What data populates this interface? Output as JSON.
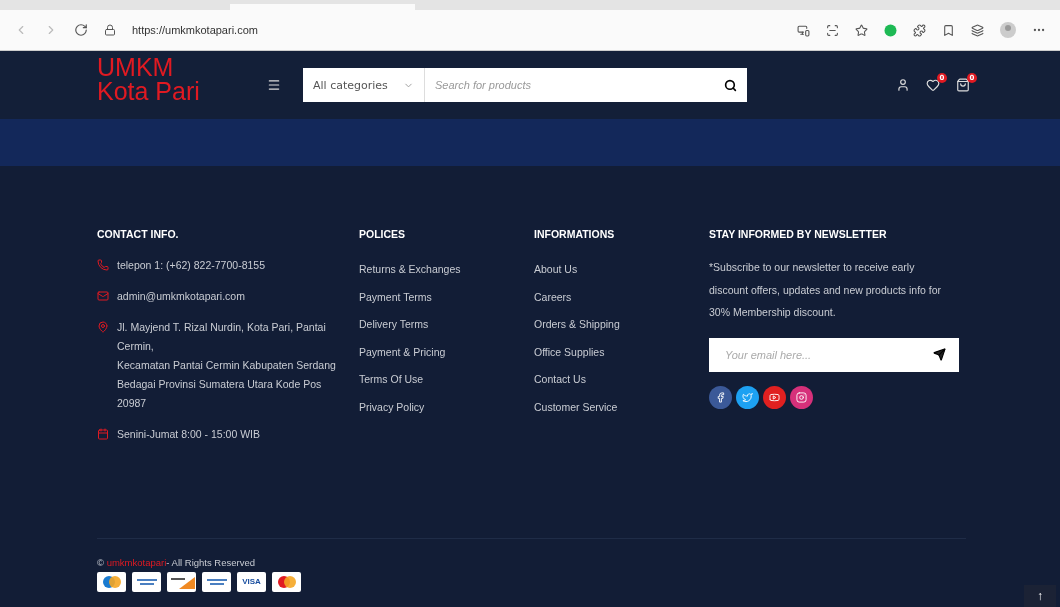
{
  "browser": {
    "url": "https://umkmkotapari.com"
  },
  "header": {
    "logo_lines": [
      "UMKM",
      "Kota Pari"
    ],
    "category": "All categories",
    "search_placeholder": "Search for products",
    "wishlist_count": "0",
    "cart_count": "0"
  },
  "footer": {
    "columns": [
      {
        "kind": "contact",
        "title": "CONTACT INFO.",
        "items": [
          {
            "lines": [
              "telepon 1: (+62) 822-7700-8155"
            ]
          },
          {
            "lines": [
              "admin@umkmkotapari.com"
            ]
          },
          {
            "lines": [
              "Jl. Mayjend T. Rizal Nurdin, Kota Pari, Pantai Cermin,",
              "Kecamatan Pantai Cermin Kabupaten Serdang Bedagai Provinsi Sumatera Utara Kode Pos 20987"
            ]
          },
          {
            "lines": [
              "Senini-Jumat 8:00 - 15:00 WIB"
            ]
          }
        ]
      },
      {
        "kind": "links",
        "title": "POLICES",
        "links": [
          "Returns & Exchanges",
          "Payment Terms",
          "Delivery Terms",
          "Payment & Pricing",
          "Terms Of Use",
          "Privacy Policy"
        ]
      },
      {
        "kind": "links",
        "title": "INFORMATIONS",
        "links": [
          "About Us",
          "Careers",
          "Orders & Shipping",
          "Office Supplies",
          "Contact Us",
          "Customer Service"
        ]
      },
      {
        "kind": "newsletter",
        "title": "STAY INFORMED BY NEWSLETTER",
        "text": "*Subscribe to our newsletter to receive early discount offers, updates and new products info for 30% Membership discount.",
        "placeholder": "Your email here...",
        "socials": [
          {
            "color": "#3b5998"
          },
          {
            "color": "#1da1f2"
          },
          {
            "color": "#e02020"
          },
          {
            "color": "#d6307a"
          }
        ]
      }
    ],
    "copyright": {
      "prefix": "©",
      "brand": "umkmkotapari",
      "suffix": "- All Rights Reserved"
    },
    "payments": [
      {
        "kind": "circles"
      },
      {
        "kind": "stripe"
      },
      {
        "kind": "corner"
      },
      {
        "kind": "stripe"
      },
      {
        "kind": "text",
        "label": "VISA"
      },
      {
        "kind": "circles2"
      }
    ]
  },
  "scroll_top": "↑"
}
